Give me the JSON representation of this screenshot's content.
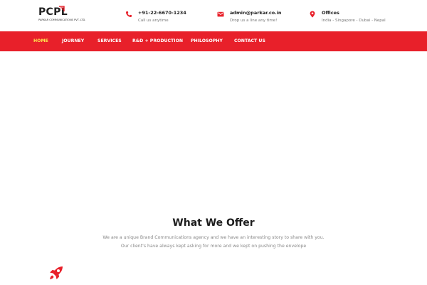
{
  "brand": {
    "logo_text": "PCPL",
    "tagline": "PARKAR COMMUNICATIONS PVT. LTD.",
    "accent_color": "#e8202a"
  },
  "contacts": [
    {
      "icon": "phone-icon",
      "main": "+91-22-6670-1234",
      "sub": "Call us anytime"
    },
    {
      "icon": "mail-icon",
      "main": "admin@parkar.co.in",
      "sub": "Drop us a line any time!"
    },
    {
      "icon": "location-pin-icon",
      "main": "Offices",
      "sub": "India - Singapore - Dubai - Nepal"
    }
  ],
  "nav": {
    "items": [
      {
        "label": "HOME",
        "active": true
      },
      {
        "label": "JOURNEY",
        "active": false
      },
      {
        "label": "SERVICES",
        "active": false
      },
      {
        "label": "R&D + PRODUCTION",
        "active": false
      },
      {
        "label": "PHILOSOPHY",
        "active": false
      },
      {
        "label": "CONTACT US",
        "active": false
      }
    ],
    "active_color": "#ffe14d"
  },
  "offer": {
    "title": "What We Offer",
    "line1": "We are a unique Brand Communications agency and we have an interesting story to share with you.",
    "line2": "Our client's have always kept asking for more and we kept on pushing the envelope",
    "icon": "rocket-icon"
  }
}
